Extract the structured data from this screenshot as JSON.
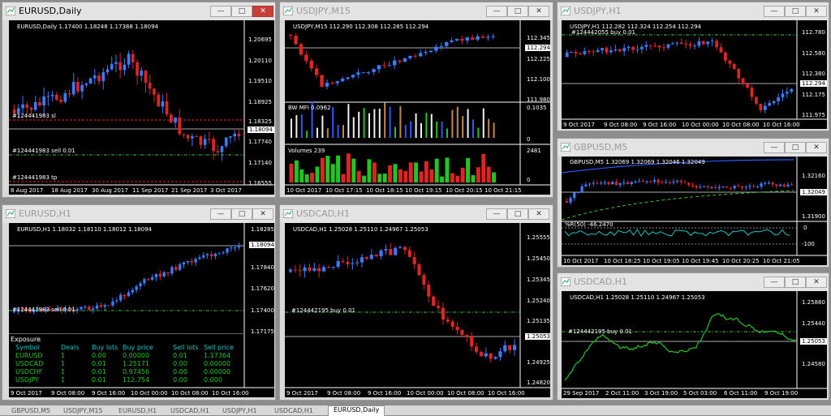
{
  "windows": [
    {
      "id": "w1",
      "title": "EURUSD,Daily",
      "active": true,
      "info": "EURUSD,Daily  1.17400 1.18248 1.17388 1.18094",
      "prices": [
        "1.20695",
        "1.20110",
        "1.19510",
        "1.18925",
        "1.18325",
        "1.17740",
        "1.17140",
        "1.16555"
      ],
      "cur_price": "1.18094",
      "dates": [
        "8 Aug 2017",
        "18 Aug 2017",
        "30 Aug 2017",
        "11 Sep 2017",
        "21 Sep 2017",
        "3 Oct 2017"
      ],
      "lines": [
        "#124441983 sl",
        "#124441983 sell 0.01",
        "#124441983 tp"
      ]
    },
    {
      "id": "w2",
      "title": "USDJPY,M15",
      "active": false,
      "info": "USDJPY,M15  112.290 112.308 112.285 112.294",
      "prices": [
        "112.345",
        "112.225",
        "112.100",
        "111.980"
      ],
      "cur_price": "112.294",
      "bw_label": "BW MFI 0.0962",
      "bw_scale": [
        "0.1035",
        "0"
      ],
      "vol_label": "Volumes 239",
      "vol_scale": [
        "2481",
        "0"
      ],
      "dates": [
        "10 Oct 2017",
        "10 Oct 17:15",
        "10 Oct 18:15",
        "10 Oct 19:15",
        "10 Oct 20:15",
        "10 Oct 21:15"
      ]
    },
    {
      "id": "w3",
      "title": "USDJPY,H1",
      "active": false,
      "info": "USDJPY,H1  112.282 112.324 112.254 112.294",
      "prices": [
        "112.780",
        "112.580",
        "112.380",
        "112.175",
        "111.975"
      ],
      "cur_price": "112.294",
      "lines": [
        "#124442055 buy 0.01"
      ],
      "dates": [
        "9 Oct 2017",
        "9 Oct 08:00",
        "9 Oct 16:00",
        "10 Oct 00:00",
        "10 Oct 08:00",
        "10 Oct 16:00"
      ]
    },
    {
      "id": "w4",
      "title": "GBPUSD,M5",
      "active": false,
      "info": "GBPUSD,M5  1.32069 1.32069 1.32046 1.32049",
      "prices": [
        "1.32160",
        "1.32049",
        "1.31900"
      ],
      "cur_price": "1.32049",
      "rsi_label": "%R(50) -46.2470",
      "rsi_scale": [
        "0",
        "-100"
      ],
      "dates": [
        "10 Oct 2017",
        "10 Oct 18:25",
        "10 Oct 19:05",
        "10 Oct 19:45",
        "10 Oct 20:25",
        "10 Oct 21:05"
      ]
    },
    {
      "id": "w5",
      "title": "EURUSD,H1",
      "active": false,
      "info": "EURUSD,H1  1.18032 1.18110 1.18012 1.18094",
      "prices": [
        "1.18285",
        "1.17840",
        "1.17620",
        "1.17400",
        "1.17175"
      ],
      "cur_price": "1.18094",
      "lines": [
        "#124441983 sell 0.01"
      ],
      "dates": [
        "9 Oct 2017",
        "9 Oct 08:00",
        "9 Oct 16:00",
        "10 Oct 00:00",
        "10 Oct 08:00",
        "10 Oct 16:00"
      ]
    },
    {
      "id": "w6",
      "title": "USDCAD,H1",
      "active": false,
      "info": "USDCAD,H1  1.25028 1.25110 1.24967 1.25053",
      "prices": [
        "1.25555",
        "1.25450",
        "1.25345",
        "1.25240",
        "1.25135",
        "1.25030",
        "1.24925",
        "1.24820"
      ],
      "cur_price": "1.25053",
      "lines": [
        "#124442195 buy 0.01"
      ],
      "dates": [
        "9 Oct 2017",
        "9 Oct 08:00",
        "9 Oct 16:00",
        "10 Oct 00:00",
        "10 Oct 08:00",
        "10 Oct 16:00"
      ]
    },
    {
      "id": "w7",
      "title": "USDCAD,H1",
      "active": false,
      "info": "USDCAD,H1  1.25028 1.25110 1.24967 1.25053",
      "prices": [
        "1.25880",
        "1.25440",
        "1.25053",
        "1.24580"
      ],
      "cur_price": "1.25053",
      "lines": [
        "#124442195 buy 0.01"
      ],
      "dates": [
        "29 Sep 2017",
        "2 Oct 11:00",
        "3 Oct 19:00",
        "5 Oct 03:00",
        "6 Oct 11:00",
        "9 Oct 19:00"
      ]
    }
  ],
  "exposure": {
    "title": "Exposure",
    "headers": [
      "Symbol",
      "Deals",
      "Buy lots",
      "Buy price",
      "Sell lots",
      "Sell price"
    ],
    "rows": [
      [
        "EURUSD",
        "1",
        "0.00",
        "0.00000",
        "0.01",
        "1.17364"
      ],
      [
        "USDCAD",
        "1",
        "0.01",
        "1.25171",
        "0.00",
        "0.00000"
      ],
      [
        "USDCHF",
        "1",
        "0.01",
        "0.97456",
        "0.00",
        "0.00000"
      ],
      [
        "USDJPY",
        "1",
        "0.01",
        "112.754",
        "0.00",
        "0.000"
      ]
    ]
  },
  "tabs": [
    "GBPUSD,M5",
    "USDJPY,M15",
    "EURUSD,H1",
    "USDCAD,H1",
    "USDJPY,H1",
    "USDCAD,H1",
    "EURUSD,Daily"
  ],
  "active_tab": "EURUSD,Daily",
  "colors": {
    "bull": "#3a7bff",
    "bear": "#e02424",
    "grid": "#555555",
    "green_dash": "#3bbf3b",
    "red_dash": "#e02424",
    "line_green": "#22c522",
    "ma_blue": "#2a5aff",
    "cyan": "#19c5c5"
  }
}
